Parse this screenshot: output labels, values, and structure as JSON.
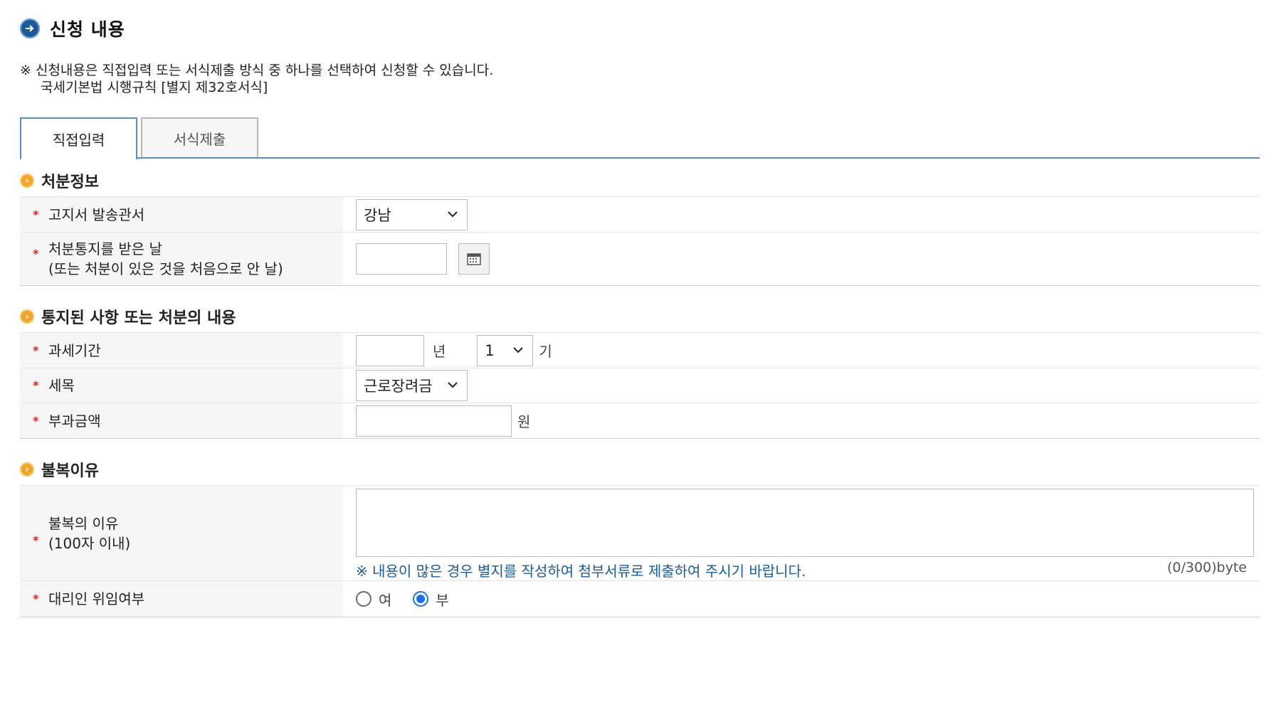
{
  "header": {
    "title": "신청 내용"
  },
  "notice": {
    "text": "※ 신청내용은 직접입력 또는 서식제출 방식 중 하나를 선택하여 신청할 수 있습니다.",
    "form_ref": "국세기본법 시행규칙 [별지 제32호서식]"
  },
  "tabs": [
    {
      "label": "직접입력",
      "active": true
    },
    {
      "label": "서식제출",
      "active": false
    }
  ],
  "sections": {
    "disposition": {
      "title": "처분정보",
      "office_label": "고지서 발송관서",
      "office_value": "강남",
      "date_label_1": "처분통지를 받은 날",
      "date_label_2": "(또는 처분이 있은 것을 처음으로 안 날)",
      "date_value": ""
    },
    "notified": {
      "title": "통지된 사항 또는 처분의 내용",
      "period_label": "과세기간",
      "year_value": "",
      "year_unit": "년",
      "term_value": "1",
      "term_unit": "기",
      "tax_item_label": "세목",
      "tax_item_value": "근로장려금",
      "amount_label": "부과금액",
      "amount_value": "",
      "amount_unit": "원"
    },
    "objection": {
      "title": "불복이유",
      "reason_label_1": "불복의 이유",
      "reason_label_2": "(100자 이내)",
      "reason_value": "",
      "hint": "※ 내용이 많은 경우 별지를 작성하여 첨부서류로 제출하여 주시기 바랍니다.",
      "counter": "(0/300)byte",
      "agent_label": "대리인 위임여부",
      "agent_options": [
        {
          "label": "여",
          "checked": false
        },
        {
          "label": "부",
          "checked": true
        }
      ]
    }
  },
  "required_mark": "*",
  "colors": {
    "accent": "#5a8fc4",
    "hint": "#1a5c9a",
    "required": "#e1251b",
    "section_icon": "#f0a62a"
  }
}
